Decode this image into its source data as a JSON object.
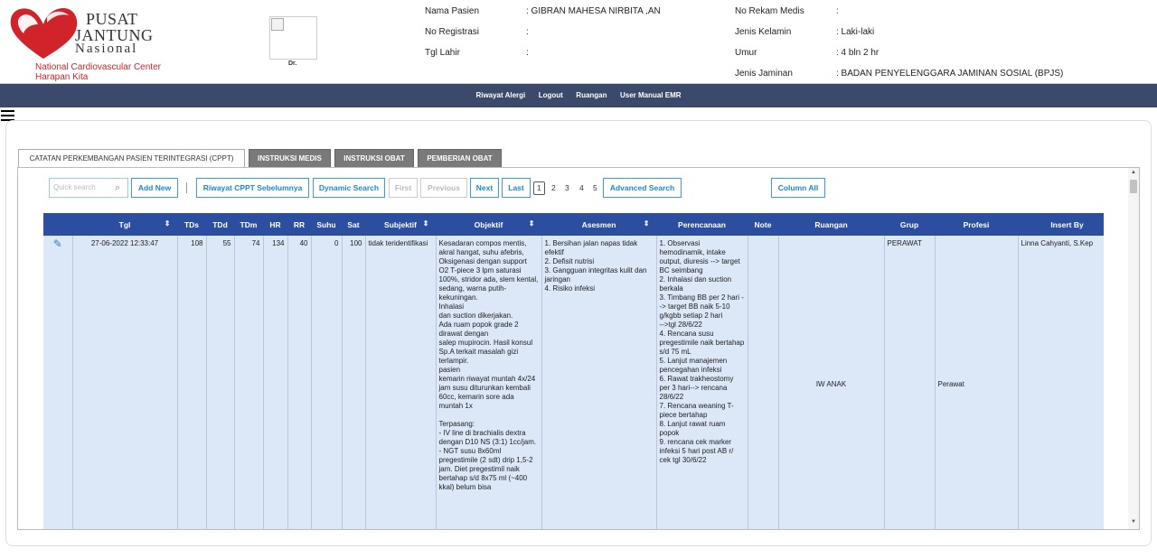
{
  "logo": {
    "line1": "PUSAT",
    "line2": "JANTUNG",
    "line3": "Nasional",
    "line4": "National Cardiovascular Center",
    "line5": "Harapan Kita",
    "color": "#c1272d"
  },
  "doctor_label": "Dr.",
  "patient": {
    "name_label": "Nama Pasien",
    "name_value": ": GIBRAN MAHESA NIRBITA ,AN",
    "reg_label": "No Registrasi",
    "reg_value": ":",
    "dob_label": "Tgl Lahir",
    "dob_value": ":",
    "rm_label": "No Rekam Medis",
    "rm_value": ":",
    "sex_label": "Jenis Kelamin",
    "sex_value": ": Laki-laki",
    "age_label": "Umur",
    "age_value": ": 4 bln 2 hr",
    "ins_label": "Jenis Jaminan",
    "ins_value": ": BADAN PENYELENGGARA JAMINAN SOSIAL (BPJS)"
  },
  "nav": {
    "items": [
      "Riwayat Alergi",
      "Logout",
      "Ruangan",
      "User Manual EMR"
    ],
    "bg_color": "#3b4a6b"
  },
  "tabs": [
    "CATATAN PERKEMBANGAN PASIEN TERINTEGRASI (CPPT)",
    "INSTRUKSI MEDIS",
    "INSTRUKSI OBAT",
    "PEMBERIAN OBAT"
  ],
  "toolbar": {
    "search_placeholder": "Quick search",
    "add_new": "Add New",
    "riwayat": "Riwayat CPPT Sebelumnya",
    "dynamic_search": "Dynamic Search",
    "first": "First",
    "previous": "Previous",
    "next": "Next",
    "last": "Last",
    "pages": [
      "1",
      "2",
      "3",
      "4",
      "5"
    ],
    "advanced_search": "Advanced Search",
    "column_all": "Column All",
    "accent_color": "#3b9ed4"
  },
  "table": {
    "header_color": "#2b4ea0",
    "row_color": "#dce7f8",
    "columns": [
      "Tgl",
      "TDs",
      "TDd",
      "TDm",
      "HR",
      "RR",
      "Suhu",
      "Sat",
      "Subjektif",
      "Objektif",
      "Asesmen",
      "Perencanaan",
      "Note",
      "Ruangan",
      "Grup",
      "Profesi",
      "Insert By"
    ],
    "row": {
      "tgl": "27-06-2022 12:33:47",
      "tds": "108",
      "tdd": "55",
      "tdm": "74",
      "hr": "134",
      "rr": "40",
      "suhu": "0",
      "sat": "100",
      "subjektif": "tidak teridentifikasi",
      "objektif": "Kesadaran compos mentis, akral hangat, suhu afebris, Oksigenasi dengan support\nO2 T-piece 3 lpm saturasi 100%, stridor ada, slem kental, sedang, warna putih-kekuningan.\nInhalasi\ndan suction dikerjakan.\nAda ruam popok grade 2 dirawat dengan\nsalep mupirocin. Hasil konsul Sp.A terkait masalah gizi terlampir.\npasien\nkemarin riwayat muntah 4x/24 jam susu diturunkan kembali 60cc, kemarin sore ada\nmuntah 1x\n\nTerpasang:\n- IV line di brachialis dextra dengan D10 NS (3:1) 1cc/jam.\n- NGT susu 8x60ml pregestimile (2 sdt) drip 1,5-2 jam. Diet pregestimil naik bertahap s/d 8x75 ml (~400 kkal) belum bisa",
      "asesmen": "1. Bersihan jalan napas tidak efektif\n2. Defisit nutrisi\n3. Gangguan integritas kulit dan jaringan\n4. Risiko infeksi",
      "perencanaan": "1. Observasi hemodinamik, intake output, diuresis --> target BC seimbang\n2. Inhalasi dan suction berkala\n3. Timbang BB per 2 hari --> target BB naik 5-10 g/kgbb setiap 2 hari\n-->tgl 28/6/22\n4. Rencana susu pregestimile naik bertahap s/d 75 mL\n5. Lanjut manajemen pencegahan infeksi\n6. Rawat trakheostomy per 3 hari--> rencana 28/6/22\n7. Rencana weaning T-piece bertahap\n8. Lanjut rawat ruam popok\n9. rencana cek marker infeksi 5 hari post AB r/ cek tgl 30/6/22",
      "note": "",
      "ruangan": "IW ANAK",
      "grup": "PERAWAT",
      "profesi": "Perawat",
      "insert_by": "Linna Cahyanti, S.Kep"
    }
  }
}
